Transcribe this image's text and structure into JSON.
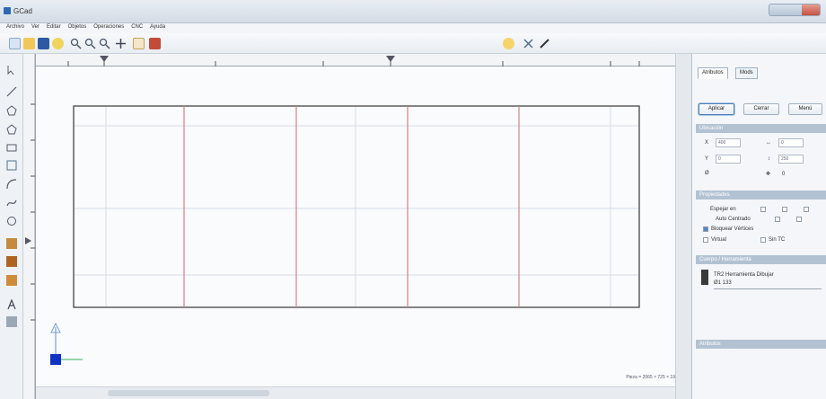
{
  "window": {
    "title": "GCad"
  },
  "menu": [
    "Archivo",
    "Ver",
    "Editar",
    "Objetos",
    "Operaciones",
    "CNC",
    "Ayuda"
  ],
  "colors": {
    "canvas_bg": "#f9fbfd",
    "grid_line": "#d7dde6",
    "part_line": "#e07a86",
    "outline": "#444444",
    "section_header": "#b3c2d3"
  },
  "statusbar": {
    "text": "Pieza = 2065 × 725 × 19"
  },
  "panel": {
    "tabs": [
      "Atributos",
      "Mods"
    ],
    "buttons": [
      "Aplicar",
      "Cerrar",
      "Menú"
    ],
    "sections": {
      "ubicacion": "Ubicación",
      "propiedades": "Propiedades",
      "tool": "Cuerpo / Herramienta",
      "bottom": "Atributos"
    },
    "fields": {
      "x_label": "X",
      "x_value": "400",
      "y_label": "Y",
      "y_value": "0",
      "z_label": "Ø",
      "w_value": "0",
      "h_value": "250",
      "rot_value": "0"
    },
    "props": {
      "espejar_label": "Espejar en",
      "auto_label": "Auto Centrado",
      "bloquear_label": "Bloquear Vértices",
      "virtual_label": "Virtual",
      "sintc_label": "Sin TC"
    },
    "tool": {
      "line1": "TR2 Herramienta Dibujar",
      "line2": "Ø1       133"
    }
  }
}
